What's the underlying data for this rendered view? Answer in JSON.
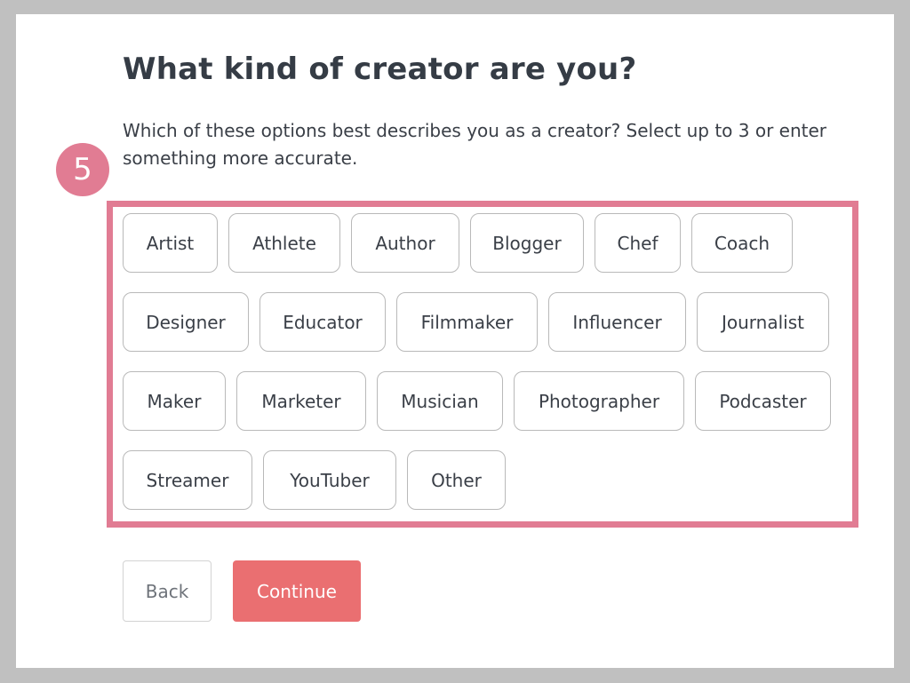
{
  "page": {
    "title": "What kind of creator are you?",
    "subtitle": "Which of these options best describes you as a creator? Select up to 3 or enter something more accurate.",
    "step_number": "5"
  },
  "options": [
    "Artist",
    "Athlete",
    "Author",
    "Blogger",
    "Chef",
    "Coach",
    "Designer",
    "Educator",
    "Filmmaker",
    "Influencer",
    "Journalist",
    "Maker",
    "Marketer",
    "Musician",
    "Photographer",
    "Podcaster",
    "Streamer",
    "YouTuber",
    "Other"
  ],
  "actions": {
    "back_label": "Back",
    "continue_label": "Continue"
  },
  "colors": {
    "accent": "#e17c93",
    "primary_button": "#ea6f71",
    "title_text": "#353c45",
    "body_text": "#3a3f47",
    "chip_border": "#b9b9b9",
    "frame_background": "#c0c0c0"
  }
}
